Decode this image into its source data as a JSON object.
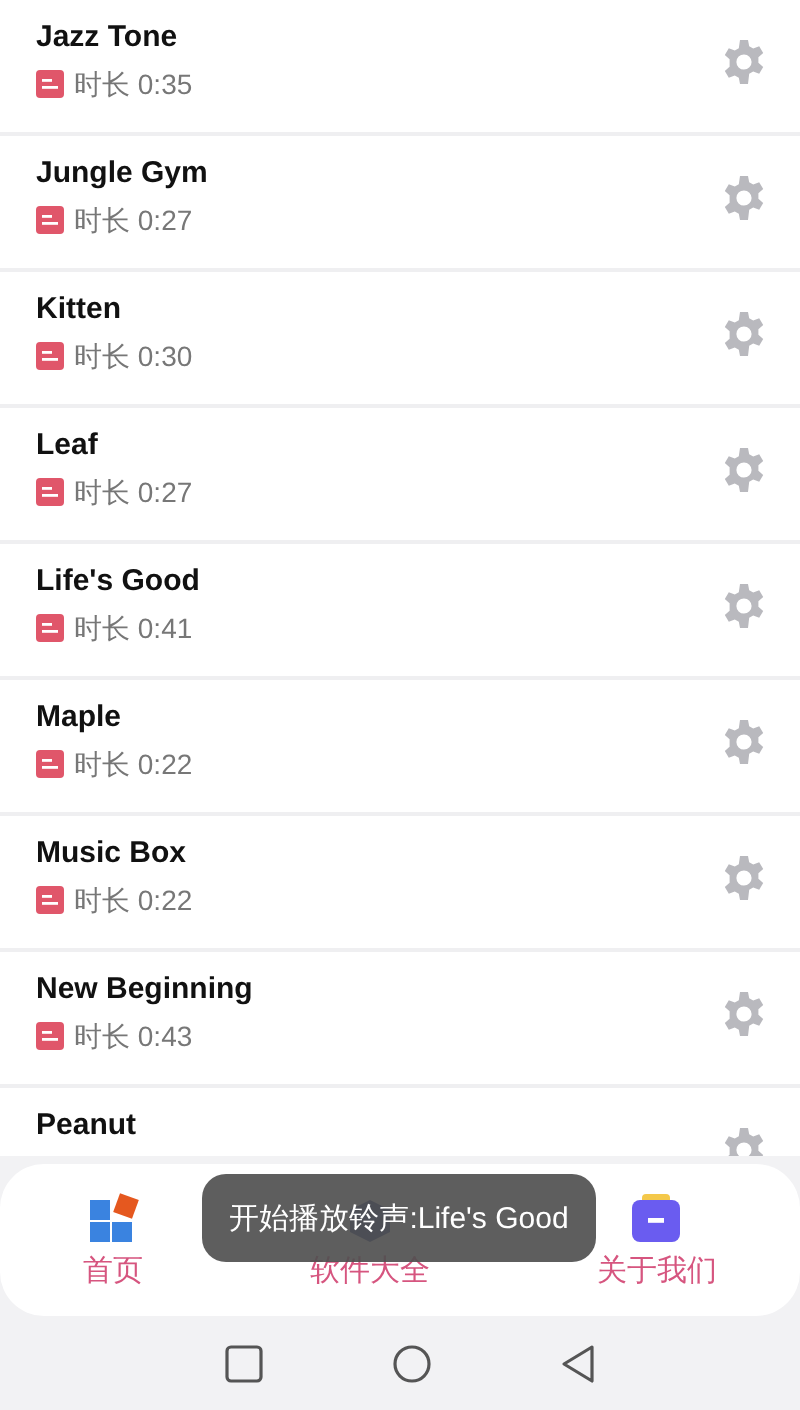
{
  "ringtones": [
    {
      "title": "Jazz Tone",
      "duration": "时长 0:35"
    },
    {
      "title": "Jungle Gym",
      "duration": "时长 0:27"
    },
    {
      "title": "Kitten",
      "duration": "时长 0:30"
    },
    {
      "title": "Leaf",
      "duration": "时长 0:27"
    },
    {
      "title": "Life's Good",
      "duration": "时长 0:41"
    },
    {
      "title": "Maple",
      "duration": "时长 0:22"
    },
    {
      "title": "Music Box",
      "duration": "时长 0:22"
    },
    {
      "title": "New Beginning",
      "duration": "时长 0:43"
    },
    {
      "title": "Peanut"
    }
  ],
  "bottom_nav": [
    {
      "label": "首页",
      "kind": "home"
    },
    {
      "label": "软件大全",
      "kind": "apps"
    },
    {
      "label": "关于我们",
      "kind": "about"
    }
  ],
  "toast": "开始播放铃声:Life's Good"
}
